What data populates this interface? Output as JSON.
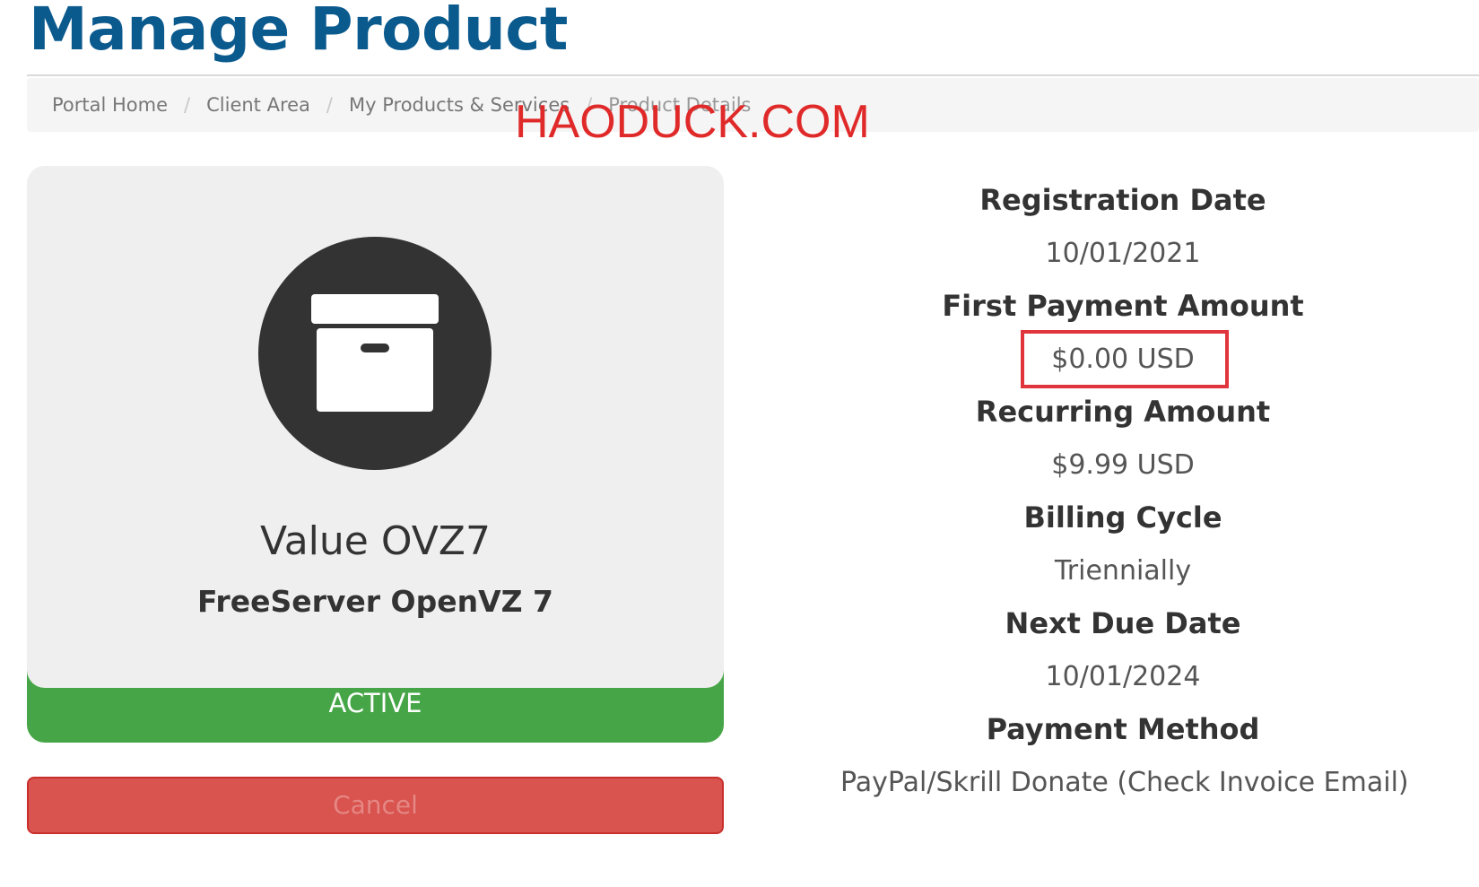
{
  "page": {
    "title": "Manage Product",
    "watermark": "HAODUCK.COM"
  },
  "breadcrumb": {
    "items": [
      {
        "label": "Portal Home"
      },
      {
        "label": "Client Area"
      },
      {
        "label": "My Products & Services"
      },
      {
        "label": "Product Details"
      }
    ],
    "separator": "/"
  },
  "product": {
    "icon": "archive-box-icon",
    "name": "Value OVZ7",
    "group": "FreeServer OpenVZ 7",
    "status": "ACTIVE",
    "status_color": "#46a546",
    "cancel_label": "Cancel",
    "cancel_color": "#d9534f"
  },
  "details": [
    {
      "label": "Registration Date",
      "value": "10/01/2021"
    },
    {
      "label": "First Payment Amount",
      "value": "$0.00 USD",
      "highlighted": true
    },
    {
      "label": "Recurring Amount",
      "value": "$9.99 USD"
    },
    {
      "label": "Billing Cycle",
      "value": "Triennially"
    },
    {
      "label": "Next Due Date",
      "value": "10/01/2024"
    },
    {
      "label": "Payment Method",
      "value": "PayPal/Skrill Donate (Check Invoice Email)"
    }
  ],
  "colors": {
    "title": "#0b5a8e",
    "highlight_border": "#e0353c",
    "watermark": "#e02a2a"
  }
}
